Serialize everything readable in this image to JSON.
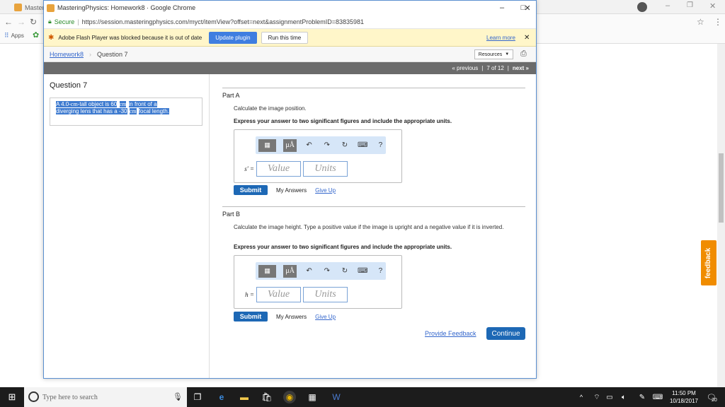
{
  "outer_browser": {
    "tab_label": "Masteri",
    "apps_label": "Apps"
  },
  "window": {
    "title": "MasteringPhysics: Homework8 · Google Chrome",
    "secure_label": "Secure",
    "url": "https://session.masteringphysics.com/myct/itemView?offset=next&assignmentProblemID=83835981"
  },
  "flash_bar": {
    "message": "Adobe Flash Player was blocked because it is out of date",
    "update_label": "Update plugin",
    "run_label": "Run this time",
    "learn_more": "Learn more"
  },
  "breadcrumb": {
    "homework": "Homework8",
    "current": "Question 7",
    "resources": "Resources"
  },
  "nav": {
    "previous": "« previous",
    "position": "7 of 12",
    "next": "next »"
  },
  "question": {
    "title": "Question 7",
    "text_a": "A 4.0-",
    "unit_a": "cm",
    "text_b": "-tall object is 60",
    "unit_b": "cm",
    "text_c": "in front of a",
    "text_d": "diverging lens that has a -30",
    "unit_c": "cm",
    "text_e": "focal length."
  },
  "part_a": {
    "title": "Part A",
    "prompt": "Calculate the image position.",
    "instruction": "Express your answer to two significant figures and include the appropriate units.",
    "variable": "s′ =",
    "value_placeholder": "Value",
    "units_placeholder": "Units",
    "submit": "Submit",
    "my_answers": "My Answers",
    "give_up": "Give Up"
  },
  "part_b": {
    "title": "Part B",
    "prompt": "Calculate the image height. Type a positive value if the image is upright and a negative value if it is inverted.",
    "instruction": "Express your answer to two significant figures and include the appropriate units.",
    "variable": "h =",
    "value_placeholder": "Value",
    "units_placeholder": "Units",
    "submit": "Submit",
    "my_answers": "My Answers",
    "give_up": "Give Up"
  },
  "footer": {
    "provide_feedback": "Provide Feedback",
    "continue": "Continue"
  },
  "feedback_tab": "feedback",
  "taskbar": {
    "search_placeholder": "Type here to search",
    "time": "11:50 PM",
    "date": "10/18/2017",
    "notifications": "20"
  },
  "colors": {
    "accent_blue": "#1d68b5",
    "flash_bar": "#fff6c9",
    "feedback": "#f08c00"
  }
}
